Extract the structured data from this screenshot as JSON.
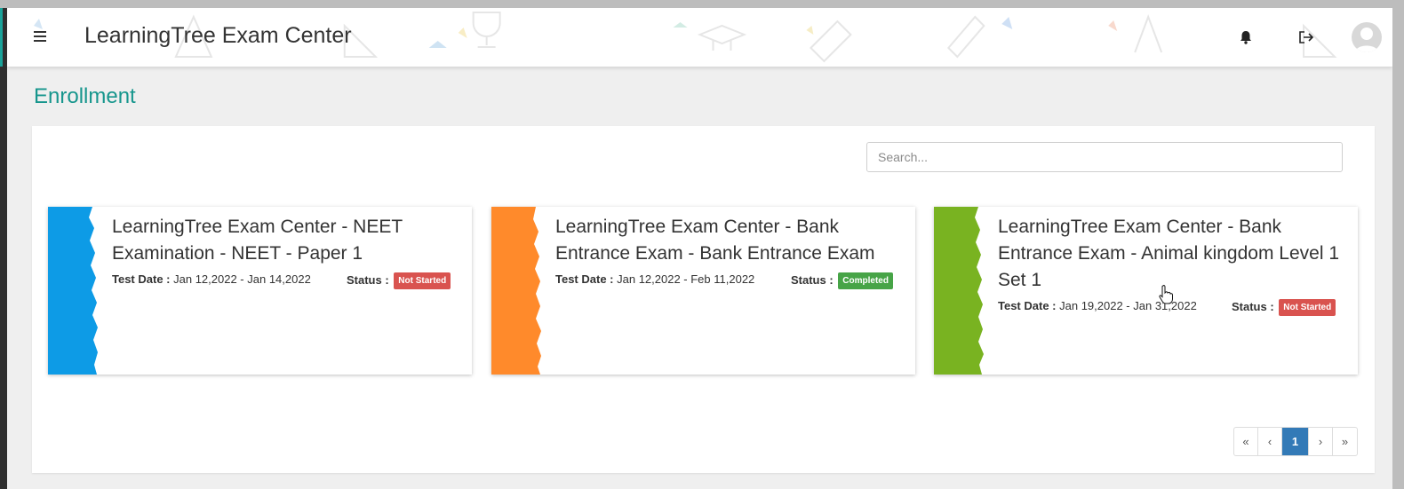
{
  "header": {
    "app_title": "LearningTree Exam Center",
    "menu_icon": "hamburger-icon",
    "notification_icon": "bell-icon",
    "logout_icon": "logout-icon",
    "avatar_icon": "user-avatar-icon"
  },
  "page": {
    "title": "Enrollment"
  },
  "search": {
    "placeholder": "Search...",
    "value": ""
  },
  "cards": [
    {
      "title": "LearningTree Exam Center - NEET Examination - NEET - Paper 1",
      "date_label": "Test Date :",
      "date_value": "Jan 12,2022 - Jan 14,2022",
      "status_label": "Status :",
      "status": "Not Started",
      "stripe_color": "#0d9be6",
      "status_color": "#d9534f"
    },
    {
      "title": "LearningTree Exam Center - Bank Entrance Exam - Bank Entrance Exam",
      "date_label": "Test Date :",
      "date_value": "Jan 12,2022 - Feb 11,2022",
      "status_label": "Status :",
      "status": "Completed",
      "stripe_color": "#ff8a2b",
      "status_color": "#47a447"
    },
    {
      "title": "LearningTree Exam Center - Bank Entrance Exam - Animal kingdom Level 1 Set 1",
      "date_label": "Test Date :",
      "date_value": "Jan 19,2022 - Jan 31,2022",
      "status_label": "Status :",
      "status": "Not Started",
      "stripe_color": "#79b321",
      "status_color": "#d9534f"
    }
  ],
  "pagination": {
    "first": "«",
    "prev": "‹",
    "current": "1",
    "next": "›",
    "last": "»"
  },
  "colors": {
    "accent": "#17968d",
    "page_bg": "#efefef",
    "active_page": "#337ab7"
  }
}
